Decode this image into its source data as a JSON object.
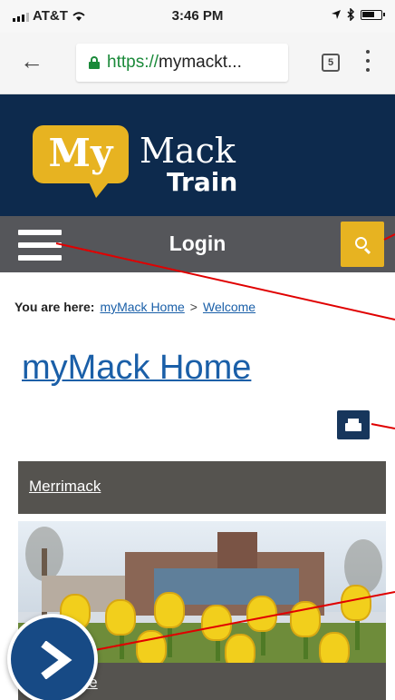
{
  "status_bar": {
    "carrier": "AT&T",
    "time": "3:46 PM"
  },
  "browser": {
    "url_scheme": "https://",
    "url_host": "mymackt...",
    "tab_count": "5"
  },
  "header": {
    "logo_my": "My",
    "logo_mack": "Mack",
    "logo_train": "Train"
  },
  "nav": {
    "title": "Login"
  },
  "breadcrumb": {
    "label": "You are here:",
    "items": [
      "myMack Home",
      "Welcome"
    ],
    "separator": ">"
  },
  "page": {
    "title": "myMack Home"
  },
  "sections": [
    {
      "label": "Merrimack"
    },
    {
      "label": "me"
    }
  ],
  "colors": {
    "header_navy": "#0d2a4d",
    "nav_gray": "#55565a",
    "accent_gold": "#e7b321",
    "link_blue": "#1a5fa8",
    "annotation_red": "#e00000"
  },
  "icons": {
    "search": "search-icon",
    "menu": "hamburger-menu-icon",
    "print": "printer-icon",
    "next": "chevron-right-icon"
  }
}
